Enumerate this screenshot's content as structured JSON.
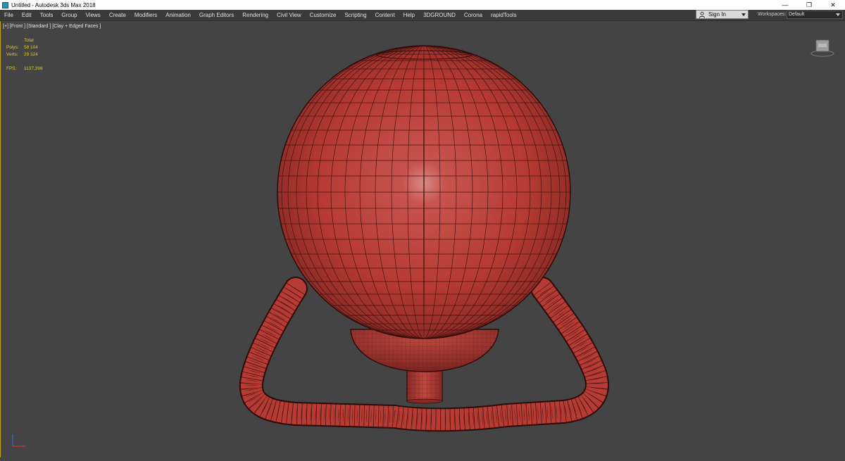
{
  "window": {
    "title": "Untitled - Autodesk 3ds Max 2018",
    "minimize": "—",
    "maximize": "❐",
    "close": "✕"
  },
  "menu": [
    "File",
    "Edit",
    "Tools",
    "Group",
    "Views",
    "Create",
    "Modifiers",
    "Animation",
    "Graph Editors",
    "Rendering",
    "Civil View",
    "Customize",
    "Scripting",
    "Content",
    "Help",
    "3DGROUND",
    "Corona",
    "rapidTools"
  ],
  "account": {
    "signin_label": "Sign In"
  },
  "workspaces": {
    "label": "Workspaces:",
    "value": "Default"
  },
  "viewport": {
    "label": "[+] [Front ] [Standard ] [Clay + Edged Faces ]",
    "stats": {
      "total_header": "Total",
      "polys_label": "Polys:",
      "polys_value": "58 104",
      "verts_label": "Verts:",
      "verts_value": "29 324",
      "fps_label": "FPS:",
      "fps_value": "1137,398"
    }
  },
  "colors": {
    "viewport_bg": "#444444",
    "clay": "#b83a34",
    "wire": "#3a0e0c",
    "stats_text": "#d8cc3a",
    "frame": "#c9a316"
  }
}
